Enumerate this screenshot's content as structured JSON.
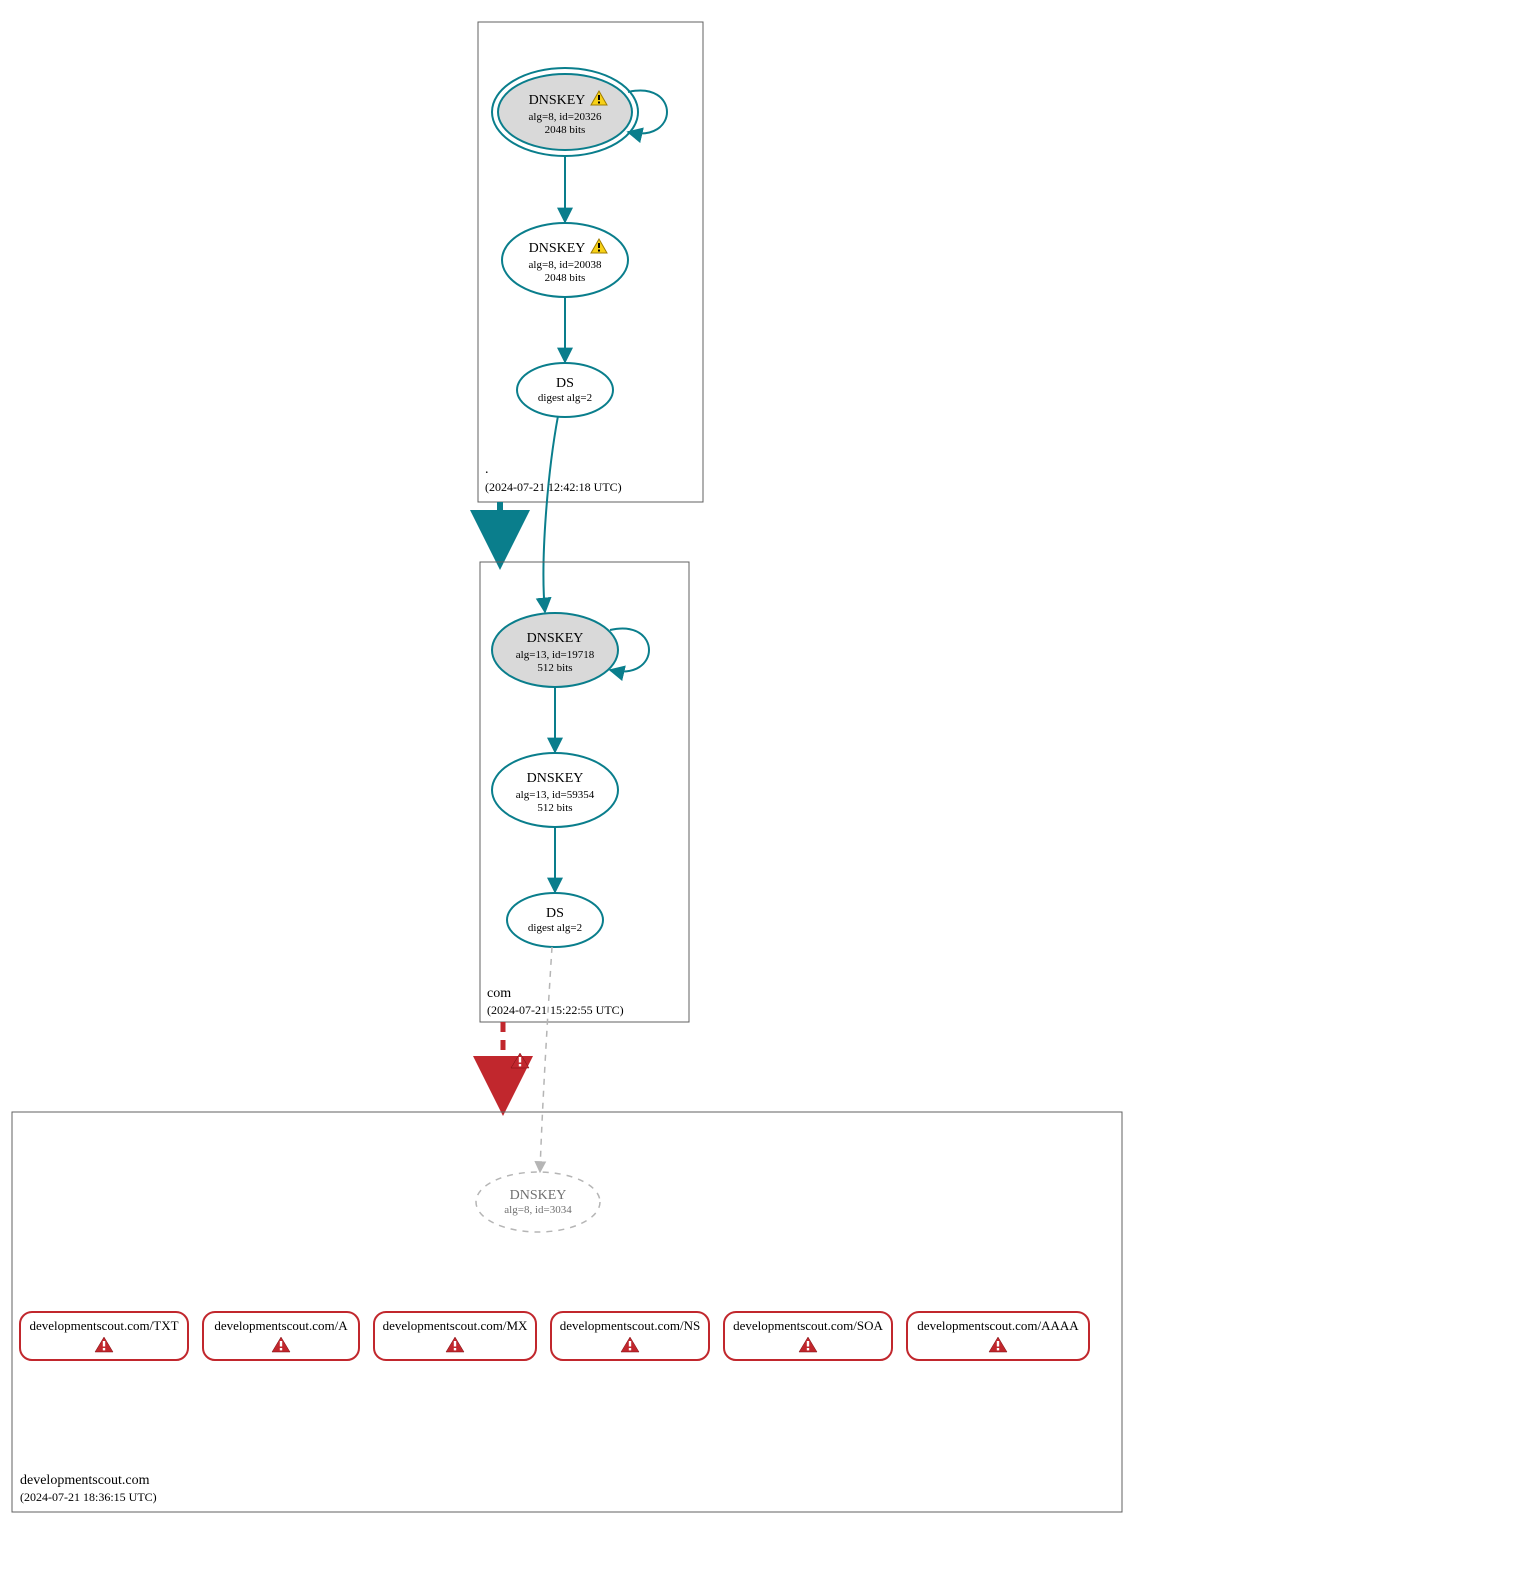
{
  "zones": {
    "root": {
      "name": ".",
      "timestamp": "(2024-07-21 12:42:18 UTC)",
      "ksk": {
        "title": "DNSKEY",
        "line1": "alg=8, id=20326",
        "line2": "2048 bits",
        "warn": true
      },
      "zsk": {
        "title": "DNSKEY",
        "line1": "alg=8, id=20038",
        "line2": "2048 bits",
        "warn": true
      },
      "ds": {
        "title": "DS",
        "line1": "digest alg=2"
      }
    },
    "com": {
      "name": "com",
      "timestamp": "(2024-07-21 15:22:55 UTC)",
      "ksk": {
        "title": "DNSKEY",
        "line1": "alg=13, id=19718",
        "line2": "512 bits"
      },
      "zsk": {
        "title": "DNSKEY",
        "line1": "alg=13, id=59354",
        "line2": "512 bits"
      },
      "ds": {
        "title": "DS",
        "line1": "digest alg=2"
      }
    },
    "domain": {
      "name": "developmentscout.com",
      "timestamp": "(2024-07-21 18:36:15 UTC)",
      "dnskey": {
        "title": "DNSKEY",
        "line1": "alg=8, id=3034"
      },
      "rrsets": [
        "developmentscout.com/TXT",
        "developmentscout.com/A",
        "developmentscout.com/MX",
        "developmentscout.com/NS",
        "developmentscout.com/SOA",
        "developmentscout.com/AAAA"
      ]
    }
  },
  "colors": {
    "teal": "#0a7e8c",
    "red": "#c1272d",
    "gray": "#b5b5b5",
    "fillGray": "#d9d9d9"
  }
}
